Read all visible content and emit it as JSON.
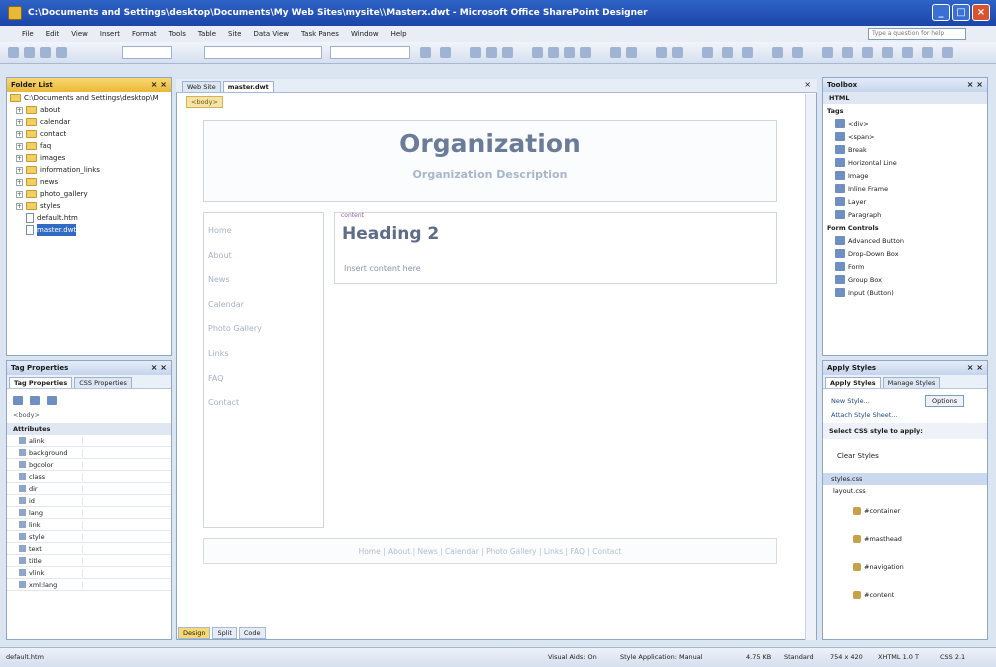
{
  "titlebar": {
    "title": "C:\\Documents and Settings\\desktop\\Documents\\My Web Sites\\mysite\\\\Masterx.dwt - Microsoft Office SharePoint Designer",
    "min": "_",
    "max": "□",
    "close": "×"
  },
  "menu": [
    "File",
    "Edit",
    "View",
    "Insert",
    "Format",
    "Tools",
    "Table",
    "Site",
    "Data View",
    "Task Panes",
    "Window",
    "Help"
  ],
  "help_placeholder": "Type a question for help",
  "folder_list": {
    "title": "Folder List",
    "root": "C:\\Documents and Settings\\desktop\\M",
    "items": [
      {
        "type": "folder",
        "label": "about"
      },
      {
        "type": "folder",
        "label": "calendar"
      },
      {
        "type": "folder",
        "label": "contact"
      },
      {
        "type": "folder",
        "label": "faq"
      },
      {
        "type": "folder",
        "label": "images"
      },
      {
        "type": "folder",
        "label": "information_links"
      },
      {
        "type": "folder",
        "label": "news"
      },
      {
        "type": "folder",
        "label": "photo_gallery"
      },
      {
        "type": "folder",
        "label": "styles"
      },
      {
        "type": "file",
        "label": "default.htm"
      },
      {
        "type": "file",
        "label": "master.dwt"
      }
    ]
  },
  "tag_properties": {
    "title": "Tag Properties",
    "tabs": [
      "Tag Properties",
      "CSS Properties"
    ],
    "body_label": "<body>",
    "attributes_header": "Attributes",
    "attributes": [
      "alink",
      "background",
      "bgcolor",
      "class",
      "dir",
      "id",
      "lang",
      "link",
      "style",
      "text",
      "title",
      "vlink",
      "xml:lang"
    ]
  },
  "document": {
    "tabs": [
      "Web Site",
      "master.dwt"
    ],
    "body_tag": "<body>",
    "org_title": "Organization",
    "org_desc": "Organization Description",
    "nav": [
      "Home",
      "About",
      "News",
      "Calendar",
      "Photo Gallery",
      "Links",
      "FAQ",
      "Contact"
    ],
    "content_tag": "content",
    "heading": "Heading 2",
    "insert_content": "Insert content here",
    "footer": "Home | About | News | Calendar | Photo Gallery | Links | FAQ | Contact",
    "view_tabs": [
      "Design",
      "Split",
      "Code"
    ]
  },
  "toolbox": {
    "title": "Toolbox",
    "section": "HTML",
    "tags_header": "Tags",
    "tags": [
      "<div>",
      "<span>",
      "Break",
      "Horizontal Line",
      "Image",
      "Inline Frame",
      "Layer",
      "Paragraph"
    ],
    "form_header": "Form Controls",
    "form_controls": [
      "Advanced Button",
      "Drop-Down Box",
      "Form",
      "Group Box",
      "Input (Button)"
    ]
  },
  "apply_styles": {
    "title": "Apply Styles",
    "tabs": [
      "Apply Styles",
      "Manage Styles"
    ],
    "new_style": "New Style...",
    "options": "Options",
    "attach": "Attach Style Sheet...",
    "select_label": "Select CSS style to apply:",
    "clear": "Clear Styles",
    "sheet": "styles.css",
    "sub": "layout.css",
    "styles": [
      "#container",
      "#masthead",
      "#navigation",
      "#content"
    ]
  },
  "status": {
    "left": "default.htm",
    "visual_aids": "Visual Aids: On",
    "style_app": "Style Application: Manual",
    "size": "4.75 KB",
    "mode": "Standard",
    "dims": "754 x 420",
    "schema": "XHTML 1.0 T",
    "css": "CSS 2.1"
  }
}
